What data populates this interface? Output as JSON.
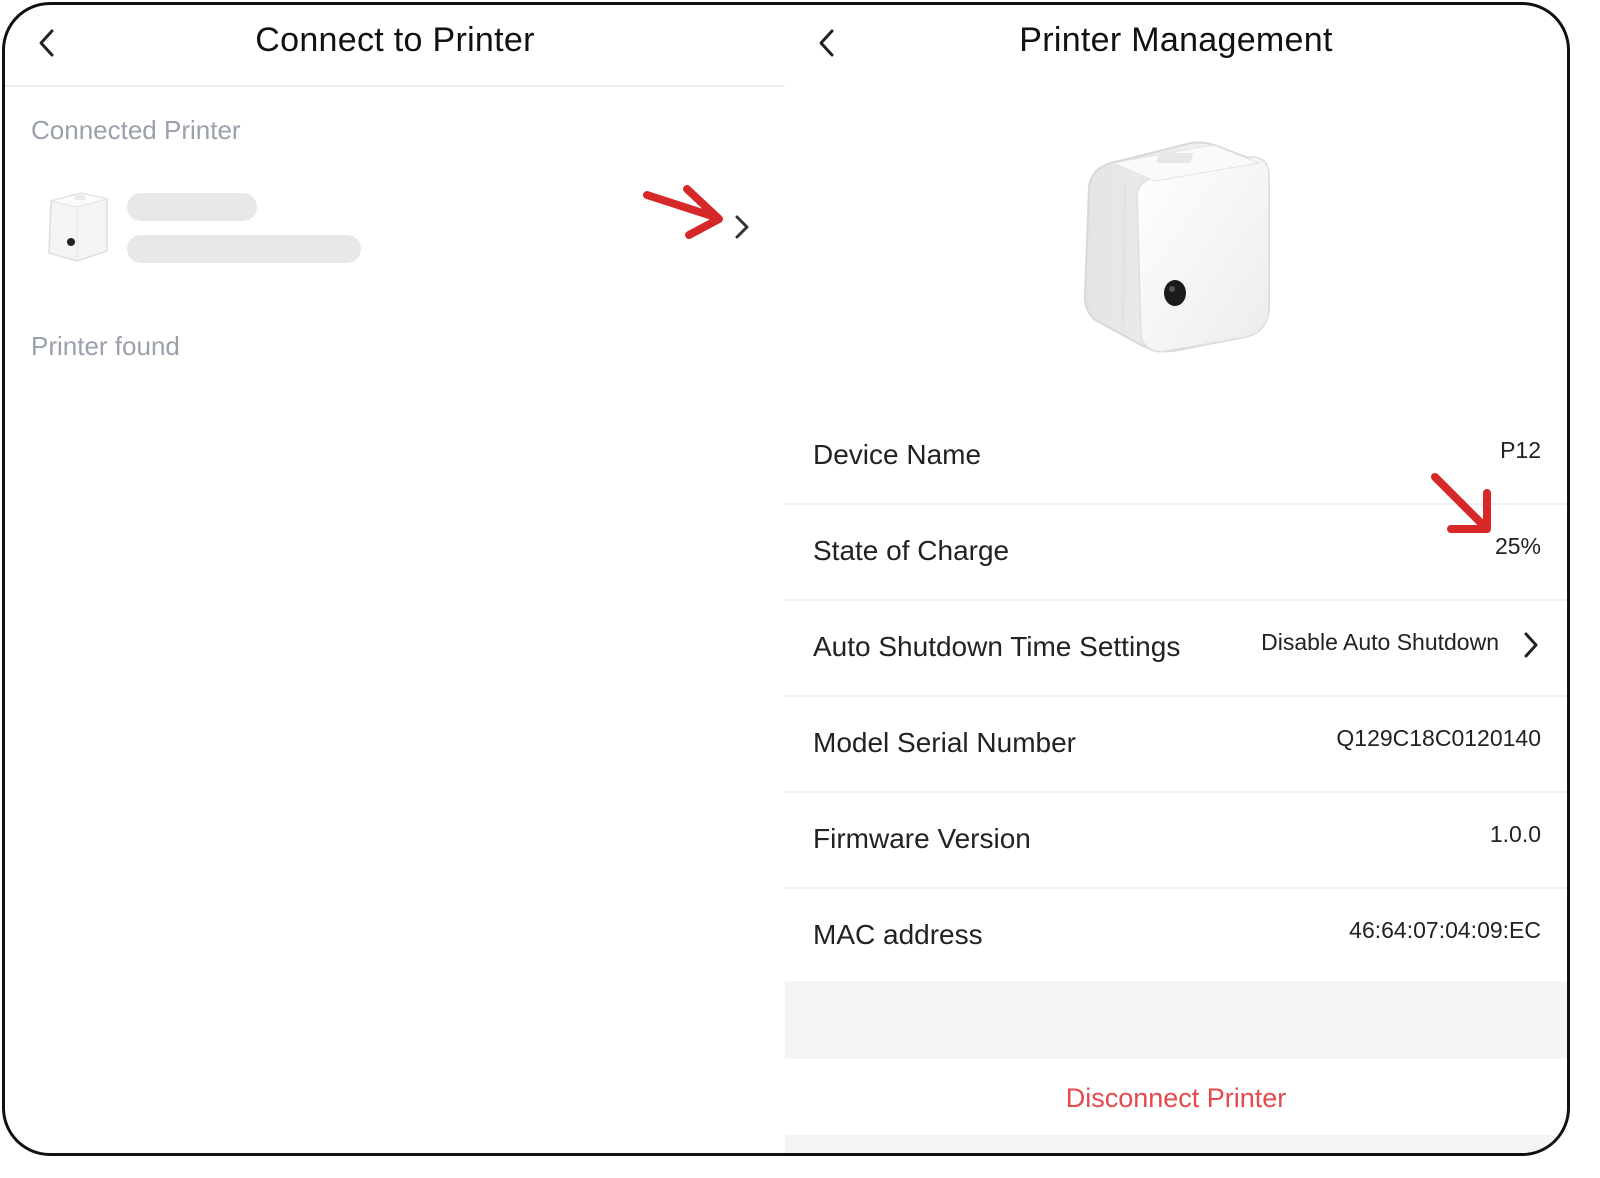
{
  "left_screen": {
    "title": "Connect to Printer",
    "connected_label": "Connected Printer",
    "found_label": "Printer found"
  },
  "right_screen": {
    "title": "Printer Management",
    "rows": [
      {
        "label": "Device Name",
        "value": "P12"
      },
      {
        "label": "State of Charge",
        "value": "25%"
      },
      {
        "label": "Auto Shutdown Time Settings",
        "value": "Disable Auto Shutdown"
      },
      {
        "label": "Model Serial Number",
        "value": "Q129C18C0120140"
      },
      {
        "label": "Firmware Version",
        "value": "1.0.0"
      },
      {
        "label": "MAC address",
        "value": "46:64:07:04:09:EC"
      }
    ],
    "disconnect_label": "Disconnect Printer"
  },
  "colors": {
    "accent_red": "#e5484d",
    "annotation_arrow": "#d62828",
    "muted_text": "#9aa1ab"
  },
  "icons": [
    "back-arrow-icon",
    "chevron-right-icon",
    "printer-image",
    "annotation-arrow-icon"
  ]
}
